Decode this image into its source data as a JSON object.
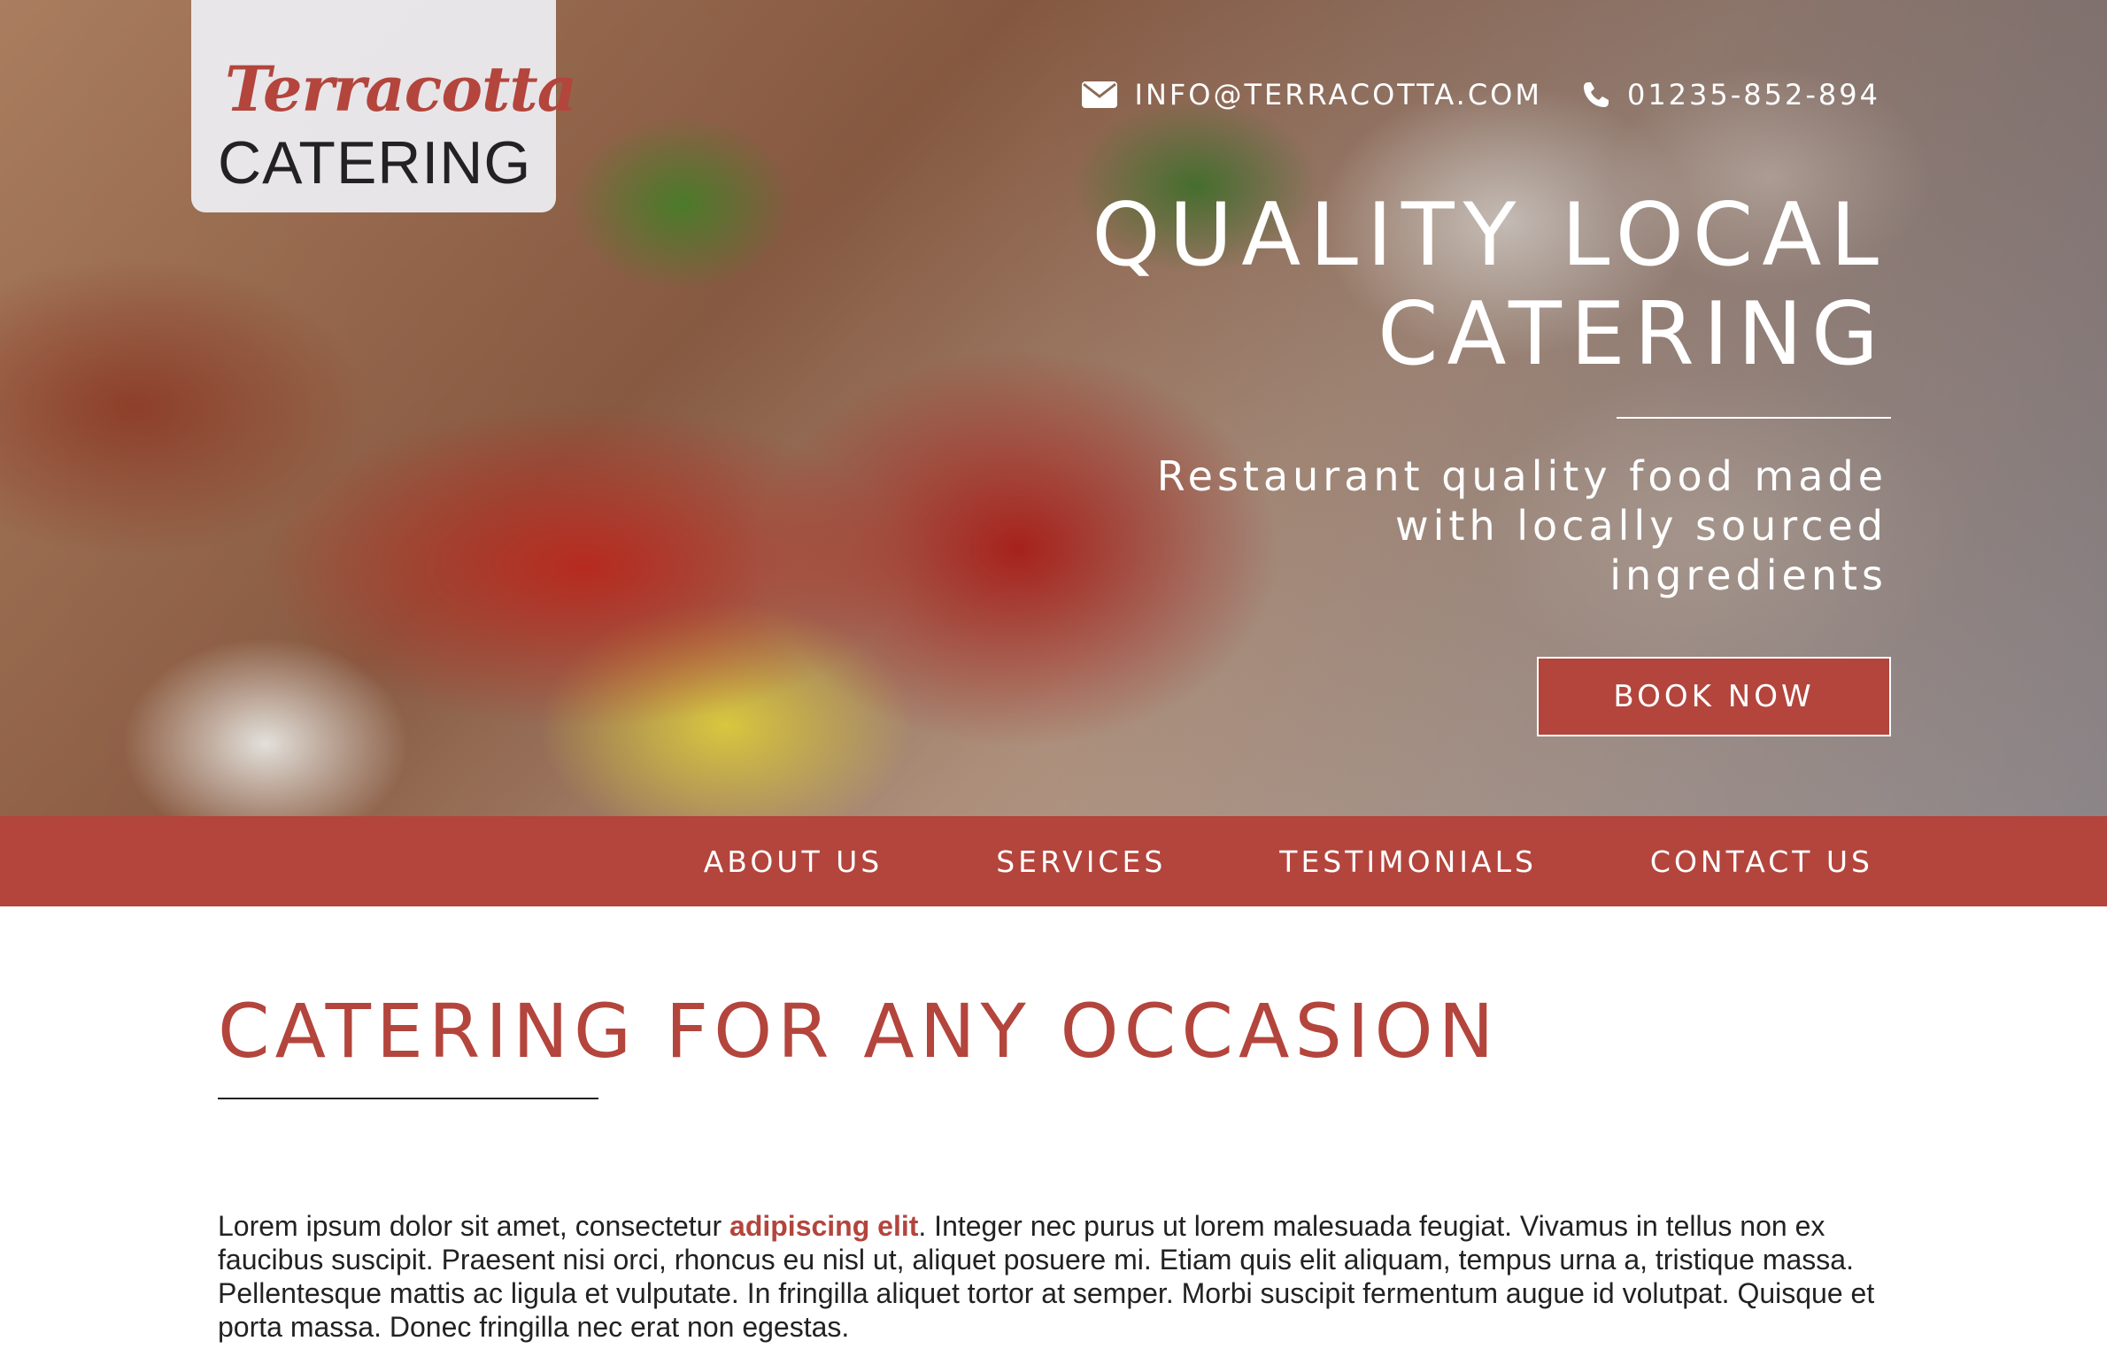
{
  "brand": {
    "script_name": "Terracotta",
    "name": "CATERING"
  },
  "contact": {
    "email": "INFO@TERRACOTTA.COM",
    "phone": "01235-852-894",
    "email_icon": "envelope-icon",
    "phone_icon": "phone-icon"
  },
  "hero": {
    "title_line1": "QUALITY LOCAL",
    "title_line2": "CATERING",
    "subtitle_line1": "Restaurant quality food made",
    "subtitle_line2": "with locally sourced",
    "subtitle_line3": "ingredients",
    "cta_label": "BOOK NOW"
  },
  "nav": {
    "items": [
      {
        "label": "ABOUT US"
      },
      {
        "label": "SERVICES"
      },
      {
        "label": "TESTIMONIALS"
      },
      {
        "label": "CONTACT US"
      }
    ]
  },
  "section": {
    "title": "CATERING FOR ANY OCCASION",
    "body_before": "Lorem ipsum dolor sit amet, consectetur ",
    "body_highlight": "adipiscing elit",
    "body_after": ". Integer nec purus ut lorem malesuada feugiat. Vivamus in tellus non ex faucibus suscipit. Praesent nisi orci, rhoncus eu nisl ut, aliquet posuere mi. Etiam quis elit aliquam, tempus urna a, tristique massa. Pellentesque mattis ac ligula et vulputate. In fringilla aliquet tortor at semper. Morbi suscipit fermentum augue id volutpat. Quisque et porta massa. Donec fringilla nec erat non egestas."
  },
  "colors": {
    "brand": "#b3453d",
    "text": "#222222",
    "white": "#ffffff"
  }
}
